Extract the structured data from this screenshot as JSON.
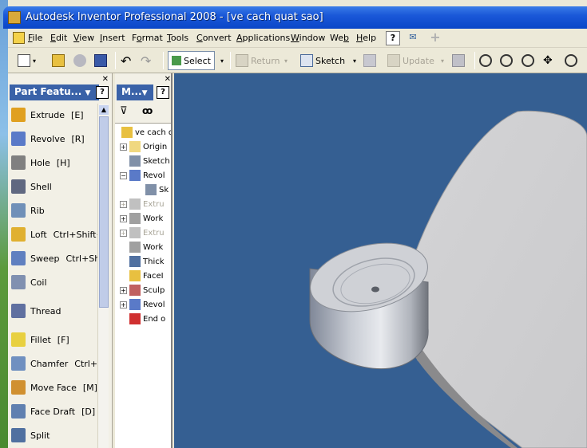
{
  "window": {
    "title": "Autodesk Inventor Professional 2008 - [ve cach quat sao]"
  },
  "menu": {
    "items": [
      {
        "name": "menu-file",
        "label": "File",
        "u": "F"
      },
      {
        "name": "menu-edit",
        "label": "Edit",
        "u": "E"
      },
      {
        "name": "menu-view",
        "label": "View",
        "u": "V"
      },
      {
        "name": "menu-insert",
        "label": "Insert",
        "u": "I"
      },
      {
        "name": "menu-format",
        "label": "Format",
        "u": "o"
      },
      {
        "name": "menu-tools",
        "label": "Tools",
        "u": "T"
      },
      {
        "name": "menu-convert",
        "label": "Convert",
        "u": "C"
      },
      {
        "name": "menu-applications",
        "label": "Applications",
        "u": "A"
      },
      {
        "name": "menu-window",
        "label": "Window",
        "u": "W"
      },
      {
        "name": "menu-web",
        "label": "Web",
        "u": "b"
      },
      {
        "name": "menu-help",
        "label": "Help",
        "u": "H"
      }
    ]
  },
  "toolbar": {
    "select_label": "Select",
    "return_label": "Return",
    "sketch_label": "Sketch",
    "update_label": "Update"
  },
  "features_panel": {
    "title": "Part Featu...",
    "items": [
      {
        "label": "Extrude",
        "shortcut": "[E]",
        "color": "#e0a020"
      },
      {
        "label": "Revolve",
        "shortcut": "[R]",
        "color": "#5a7ac8"
      },
      {
        "label": "Hole",
        "shortcut": "[H]",
        "color": "#808080"
      },
      {
        "label": "Shell",
        "shortcut": "",
        "color": "#606880"
      },
      {
        "label": "Rib",
        "shortcut": "",
        "color": "#7090b8"
      },
      {
        "label": "Loft",
        "shortcut": "Ctrl+Shift+",
        "color": "#e0b030"
      },
      {
        "label": "Sweep",
        "shortcut": "Ctrl+Shif",
        "color": "#6080c0"
      },
      {
        "label": "Coil",
        "shortcut": "",
        "color": "#8090b0"
      },
      {
        "label": "Thread",
        "shortcut": "",
        "color": "#6070a0"
      },
      {
        "label": "Fillet",
        "shortcut": "[F]",
        "color": "#e8d040"
      },
      {
        "label": "Chamfer",
        "shortcut": "Ctrl+Sh",
        "color": "#7090c0"
      },
      {
        "label": "Move Face",
        "shortcut": "[M]",
        "color": "#d09030"
      },
      {
        "label": "Face Draft",
        "shortcut": "[D]",
        "color": "#6080b0"
      },
      {
        "label": "Split",
        "shortcut": "",
        "color": "#5070a0"
      }
    ]
  },
  "browser_panel": {
    "title": "M...",
    "items": [
      {
        "label": "ve cach q",
        "pm": "",
        "dis": false,
        "color": "#e8c040",
        "indent": 0
      },
      {
        "label": "Origin",
        "pm": "+",
        "dis": false,
        "color": "#f0d880",
        "indent": 1
      },
      {
        "label": "Sketch",
        "pm": "",
        "dis": false,
        "color": "#8090a8",
        "indent": 1
      },
      {
        "label": "Revol",
        "pm": "−",
        "dis": false,
        "color": "#5a7ac8",
        "indent": 1
      },
      {
        "label": "Sk",
        "pm": "",
        "dis": false,
        "color": "#8090a8",
        "indent": 2
      },
      {
        "label": "Extru",
        "pm": "+",
        "dis": true,
        "color": "#c0c0c0",
        "indent": 1
      },
      {
        "label": "Work",
        "pm": "+",
        "dis": false,
        "color": "#a0a0a0",
        "indent": 1
      },
      {
        "label": "Extru",
        "pm": "+",
        "dis": true,
        "color": "#c0c0c0",
        "indent": 1
      },
      {
        "label": "Work",
        "pm": "",
        "dis": false,
        "color": "#a0a0a0",
        "indent": 1
      },
      {
        "label": "Thick",
        "pm": "",
        "dis": false,
        "color": "#5070a0",
        "indent": 1
      },
      {
        "label": "FaceI",
        "pm": "",
        "dis": false,
        "color": "#e8c040",
        "indent": 1
      },
      {
        "label": "Sculp",
        "pm": "+",
        "dis": false,
        "color": "#c06060",
        "indent": 1
      },
      {
        "label": "Revol",
        "pm": "+",
        "dis": false,
        "color": "#5a7ac8",
        "indent": 1
      },
      {
        "label": "End o",
        "pm": "",
        "dis": false,
        "color": "#d03030",
        "indent": 1
      }
    ]
  },
  "viewport": {
    "background": "#355f92"
  }
}
